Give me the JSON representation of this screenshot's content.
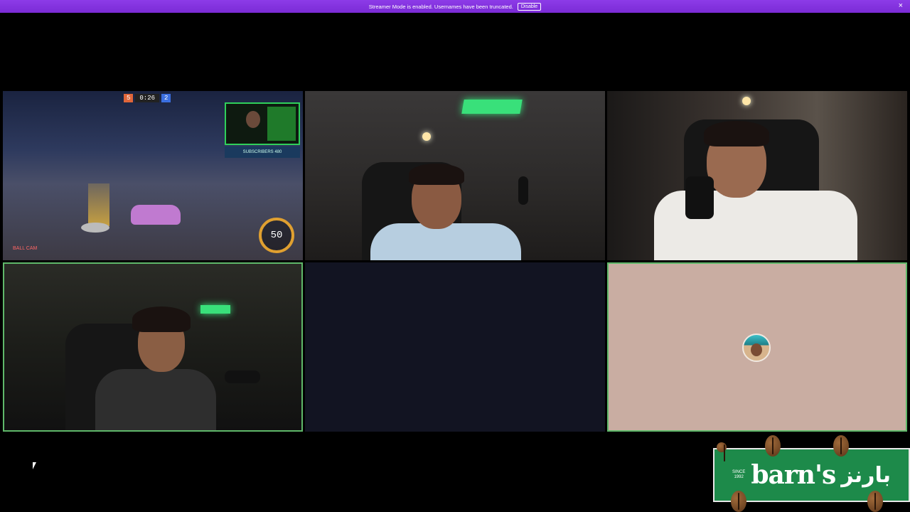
{
  "banner": {
    "text": "Streamer Mode is enabled. Usernames have been truncated.",
    "button_label": "Disable",
    "close_glyph": "×"
  },
  "game_tile": {
    "score_left": "5",
    "time": "0:26",
    "score_right": "2",
    "subscriber_text": "SUBSCRIBERS 480",
    "boost": "50",
    "ball_cam": "BALL CAM"
  },
  "ad": {
    "since": "SINCE\n1992",
    "brand_latin": "barn's",
    "brand_arabic": "بارنز",
    "accent_color": "#1d8a4a"
  },
  "colors": {
    "banner": "#8d3be8",
    "speaking_border": "#5fb86a",
    "background": "#000000"
  },
  "icons": {
    "banner_close": "close-icon",
    "cursor": "mouse-pointer-icon",
    "participant_avatar": "avatar-icon"
  }
}
